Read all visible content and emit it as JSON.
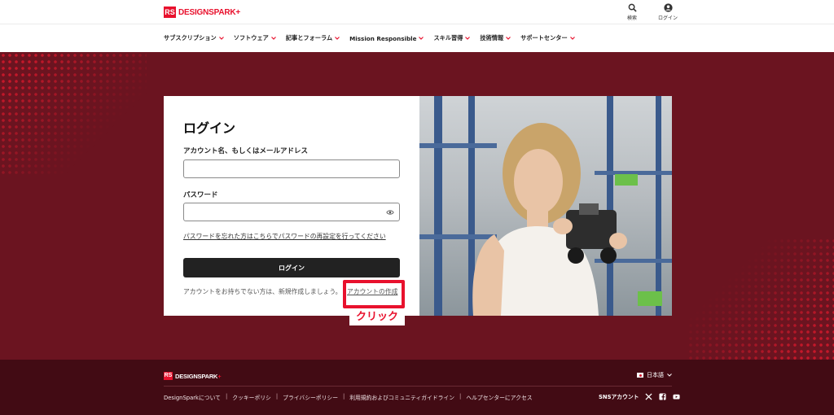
{
  "header": {
    "logo_box": "RS",
    "logo_text": "DESIGNSPARK",
    "logo_plus": "+",
    "search_label": "検索",
    "login_label": "ログイン"
  },
  "nav": [
    {
      "label": "サブスクリプション"
    },
    {
      "label": "ソフトウェア"
    },
    {
      "label": "記事とフォーラム"
    },
    {
      "label": "Mission Responsible"
    },
    {
      "label": "スキル習得"
    },
    {
      "label": "技術情報"
    },
    {
      "label": "サポートセンター"
    }
  ],
  "login": {
    "title": "ログイン",
    "account_label": "アカウント名、もしくはメールアドレス",
    "account_value": "",
    "password_label": "パスワード",
    "password_value": "",
    "forgot_link": "パスワードを忘れた方はこちらでパスワードの再設定を行ってください",
    "submit_label": "ログイン",
    "signup_prompt": "アカウントをお持ちでない方は、新規作成しましょう。",
    "signup_link": "アカウントの作成"
  },
  "annotation": {
    "click_label": "クリック",
    "highlight_color": "#e8112d"
  },
  "footer": {
    "logo_box": "RS",
    "logo_text": "DESIGNSPARK",
    "logo_plus": "+",
    "language": "日本語",
    "links": [
      "DesignSparkについて",
      "クッキーポリシ",
      "プライバシーポリシー",
      "利用規約およびコミュニティガイドライン",
      "ヘルプセンターにアクセス"
    ],
    "sns_label": "SNSアカウント"
  },
  "colors": {
    "brand_red": "#e8112d",
    "hero_bg": "#6b1420",
    "footer_bg": "#420b14"
  }
}
